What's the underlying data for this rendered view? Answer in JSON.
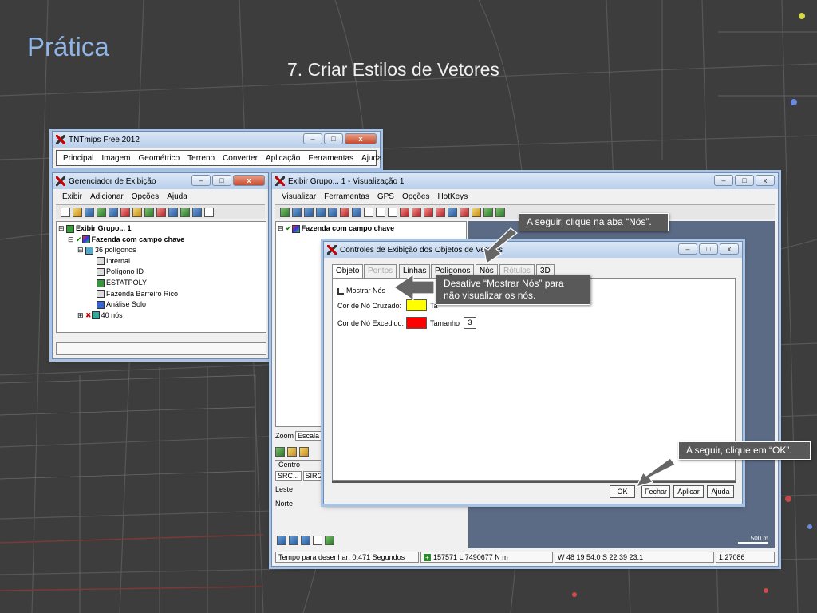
{
  "slide": {
    "title": "Prática",
    "subtitle": "7. Criar Estilos de Vetores"
  },
  "colors": {
    "accent_title": "#8fb4e6",
    "callout_bg": "#595959",
    "swatch_crossed": "#ffff00",
    "swatch_exceeded": "#ff0000",
    "map_bg": "#5b6a85"
  },
  "tnt_window": {
    "title": "TNTmips Free 2012",
    "menu": [
      "Principal",
      "Imagem",
      "Geométrico",
      "Terreno",
      "Converter",
      "Aplicação",
      "Ferramentas",
      "Ajuda"
    ]
  },
  "manager_window": {
    "title": "Gerenciador de Exibição",
    "menu": [
      "Exibir",
      "Adicionar",
      "Opções",
      "Ajuda"
    ],
    "tree": [
      "Exibir Grupo... 1",
      "Fazenda com campo chave",
      "36 polígonos",
      "Internal",
      "Polígono ID",
      "ESTATPOLY",
      "Fazenda Barreiro Rico",
      "Análise Solo",
      "40 nós"
    ]
  },
  "view_window": {
    "title": "Exibir Grupo... 1 - Visualização 1",
    "menu": [
      "Visualizar",
      "Ferramentas",
      "GPS",
      "Opções",
      "HotKeys"
    ],
    "tree_item": "Fazenda com campo chave",
    "left_labels": {
      "zoom": "Zoom",
      "scale": "Escala",
      "center": "Centro",
      "src": "SRC...",
      "sirg": "SIRG",
      "east": "Leste",
      "north": "Norte"
    },
    "scale_bar": "500 m",
    "status": {
      "draw_time": "Tempo para desenhar: 0.471 Segundos",
      "utm": "157571 L  7490677 N m",
      "latlon": "W 48 19 54.0  S 22 39 23.1",
      "scale": "1:27086"
    }
  },
  "dialog": {
    "title": "Controles de Exibição dos Objetos de Vetores",
    "tabs": [
      {
        "label": "Objeto",
        "state": "active"
      },
      {
        "label": "Pontos",
        "state": "disabled"
      },
      {
        "label": "Linhas",
        "state": "normal"
      },
      {
        "label": "Polígonos",
        "state": "normal"
      },
      {
        "label": "Nós",
        "state": "normal"
      },
      {
        "label": "Rótulos",
        "state": "disabled"
      },
      {
        "label": "3D",
        "state": "normal"
      }
    ],
    "show_nodes": "Mostrar Nós",
    "crossed_label": "Cor de Nó Cruzado:",
    "exceeded_label": "Cor de Nó Excedido:",
    "size_label": "Tamanho",
    "size_label_partial": "Ta",
    "size_value": "3",
    "buttons": {
      "ok": "OK",
      "close": "Fechar",
      "apply": "Aplicar",
      "help": "Ajuda"
    }
  },
  "callouts": {
    "click_nodes_tab": "A seguir, clique na aba “Nós”.",
    "disable_show_nodes": "Desative “Mostrar Nós” para não visualizar os nós.",
    "click_ok": "A seguir, clique em “OK”."
  }
}
